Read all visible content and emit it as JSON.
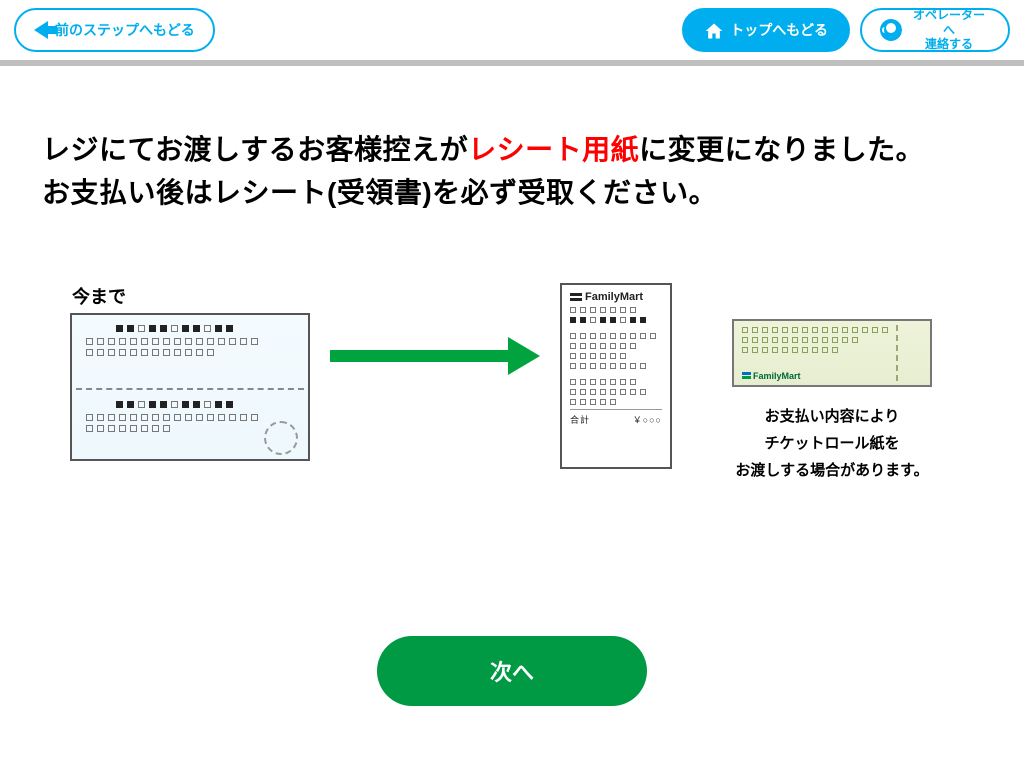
{
  "topbar": {
    "back_label": "前のステップへもどる",
    "top_label": "トップへもどる",
    "operator_label": "オペレーターへ\n連絡する"
  },
  "headline": {
    "part1": "レジにてお渡しするお客様控えが",
    "highlight": "レシート用紙",
    "part2": "に変更になりました。",
    "line2": "お支払い後はレシート(受領書)を必ず受取ください。"
  },
  "diagram": {
    "before_label": "今まで",
    "familymart_label": "FamilyMart",
    "total_label": "合計",
    "total_value": "￥○○○"
  },
  "ticket_note": {
    "l1": "お支払い内容により",
    "l2": "チケットロール紙を",
    "l3": "お渡しする場合があります。"
  },
  "next_label": "次へ"
}
